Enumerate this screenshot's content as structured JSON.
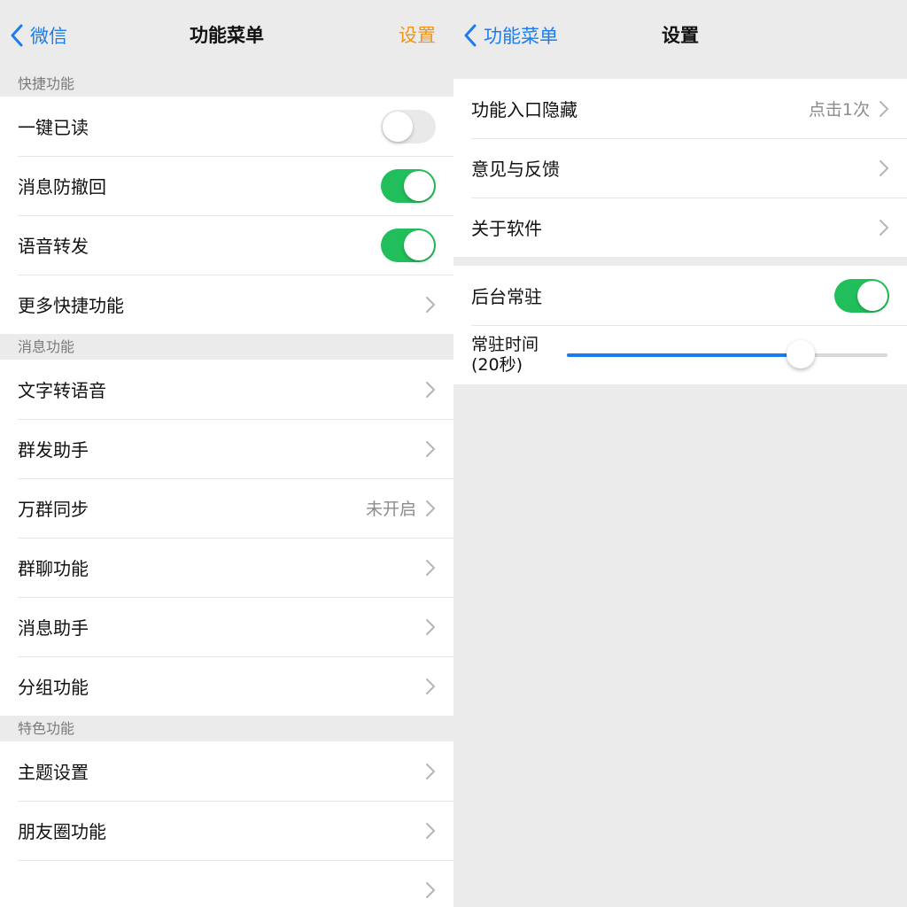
{
  "left": {
    "nav": {
      "back_label": "微信",
      "title": "功能菜单",
      "action_label": "设置"
    },
    "sections": [
      {
        "header": "快捷功能",
        "rows": [
          {
            "label": "一键已读",
            "type": "toggle",
            "on": false
          },
          {
            "label": "消息防撤回",
            "type": "toggle",
            "on": true
          },
          {
            "label": "语音转发",
            "type": "toggle",
            "on": true
          },
          {
            "label": "更多快捷功能",
            "type": "link"
          }
        ]
      },
      {
        "header": "消息功能",
        "rows": [
          {
            "label": "文字转语音",
            "type": "link"
          },
          {
            "label": "群发助手",
            "type": "link"
          },
          {
            "label": "万群同步",
            "type": "link",
            "value": "未开启"
          },
          {
            "label": "群聊功能",
            "type": "link"
          },
          {
            "label": "消息助手",
            "type": "link"
          },
          {
            "label": "分组功能",
            "type": "link"
          }
        ]
      },
      {
        "header": "特色功能",
        "rows": [
          {
            "label": "主题设置",
            "type": "link"
          },
          {
            "label": "朋友圈功能",
            "type": "link"
          },
          {
            "label": "",
            "type": "link"
          }
        ]
      }
    ]
  },
  "right": {
    "nav": {
      "back_label": "功能菜单",
      "title": "设置"
    },
    "group1": [
      {
        "label": "功能入口隐藏",
        "type": "link",
        "value": "点击1次"
      },
      {
        "label": "意见与反馈",
        "type": "link"
      },
      {
        "label": "关于软件",
        "type": "link"
      }
    ],
    "background_toggle": {
      "label": "后台常驻",
      "on": true
    },
    "resident_time": {
      "label_line1": "常驻时间",
      "label_line2": "(20秒)",
      "fraction": 0.73
    }
  },
  "colors": {
    "accent_blue": "#1a7cf0",
    "accent_orange": "#f0941c",
    "toggle_green": "#21bf5b",
    "toggle_off": "#e9e9ea",
    "background": "#ebebeb"
  },
  "icons": {
    "back": "chevron-left-icon",
    "disclosure": "chevron-right-icon"
  }
}
